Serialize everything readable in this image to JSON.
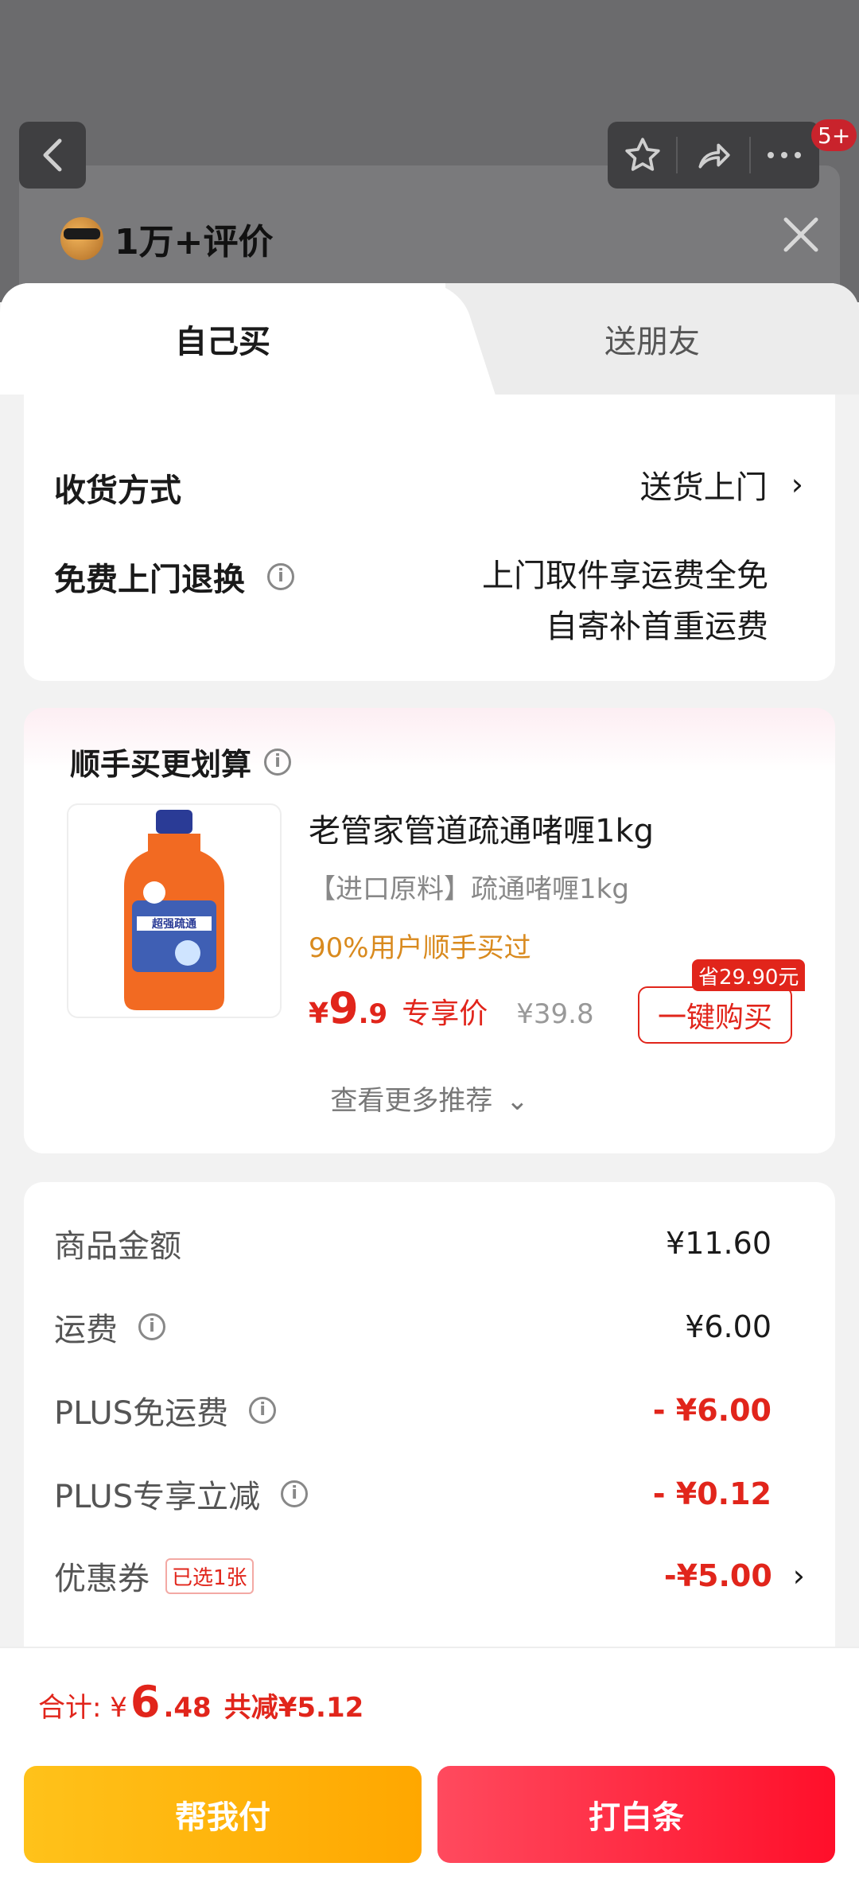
{
  "background": {
    "badge": "5+",
    "rating_text": "1万+评价"
  },
  "tabs": [
    {
      "label": "自己买",
      "active": true
    },
    {
      "label": "送朋友",
      "active": false
    }
  ],
  "delivery": {
    "method_label": "收货方式",
    "method_value": "送货上门",
    "return_label": "免费上门退换",
    "return_line1": "上门取件享运费全免",
    "return_line2": "自寄补首重运费"
  },
  "addon": {
    "title": "顺手买更划算",
    "product_title": "老管家管道疏通啫喱1kg",
    "product_subtitle": "【进口原料】疏通啫喱1kg",
    "social_proof": "90%用户顺手买过",
    "price_symbol": "¥",
    "price_int": "9",
    "price_dec": ".9",
    "price_tag": "专享价",
    "original_price": "¥39.8",
    "save_badge": "省29.90元",
    "buy_button": "一键购买",
    "more_link": "查看更多推荐",
    "bottle_label": "超强疏通"
  },
  "summary": {
    "rows": [
      {
        "label": "商品金额",
        "value": "¥11.60"
      },
      {
        "label": "运费",
        "value": "¥6.00"
      },
      {
        "label": "PLUS免运费",
        "value": "- ¥6.00"
      },
      {
        "label": "PLUS专享立减",
        "value": "- ¥0.12"
      },
      {
        "label": "优惠券",
        "value": "-¥5.00",
        "tag": "已选1张"
      }
    ]
  },
  "footer": {
    "total_label": "合计: ¥",
    "total_int": "6",
    "total_dec": ".48",
    "discount": "共减¥5.12",
    "help_pay": "帮我付",
    "iou_pay": "打白条"
  },
  "colors": {
    "accent_red": "#e1251b",
    "orange_text": "#d98a1e",
    "help_btn": "#ffb30f",
    "iou_btn": "#ff2a40"
  }
}
